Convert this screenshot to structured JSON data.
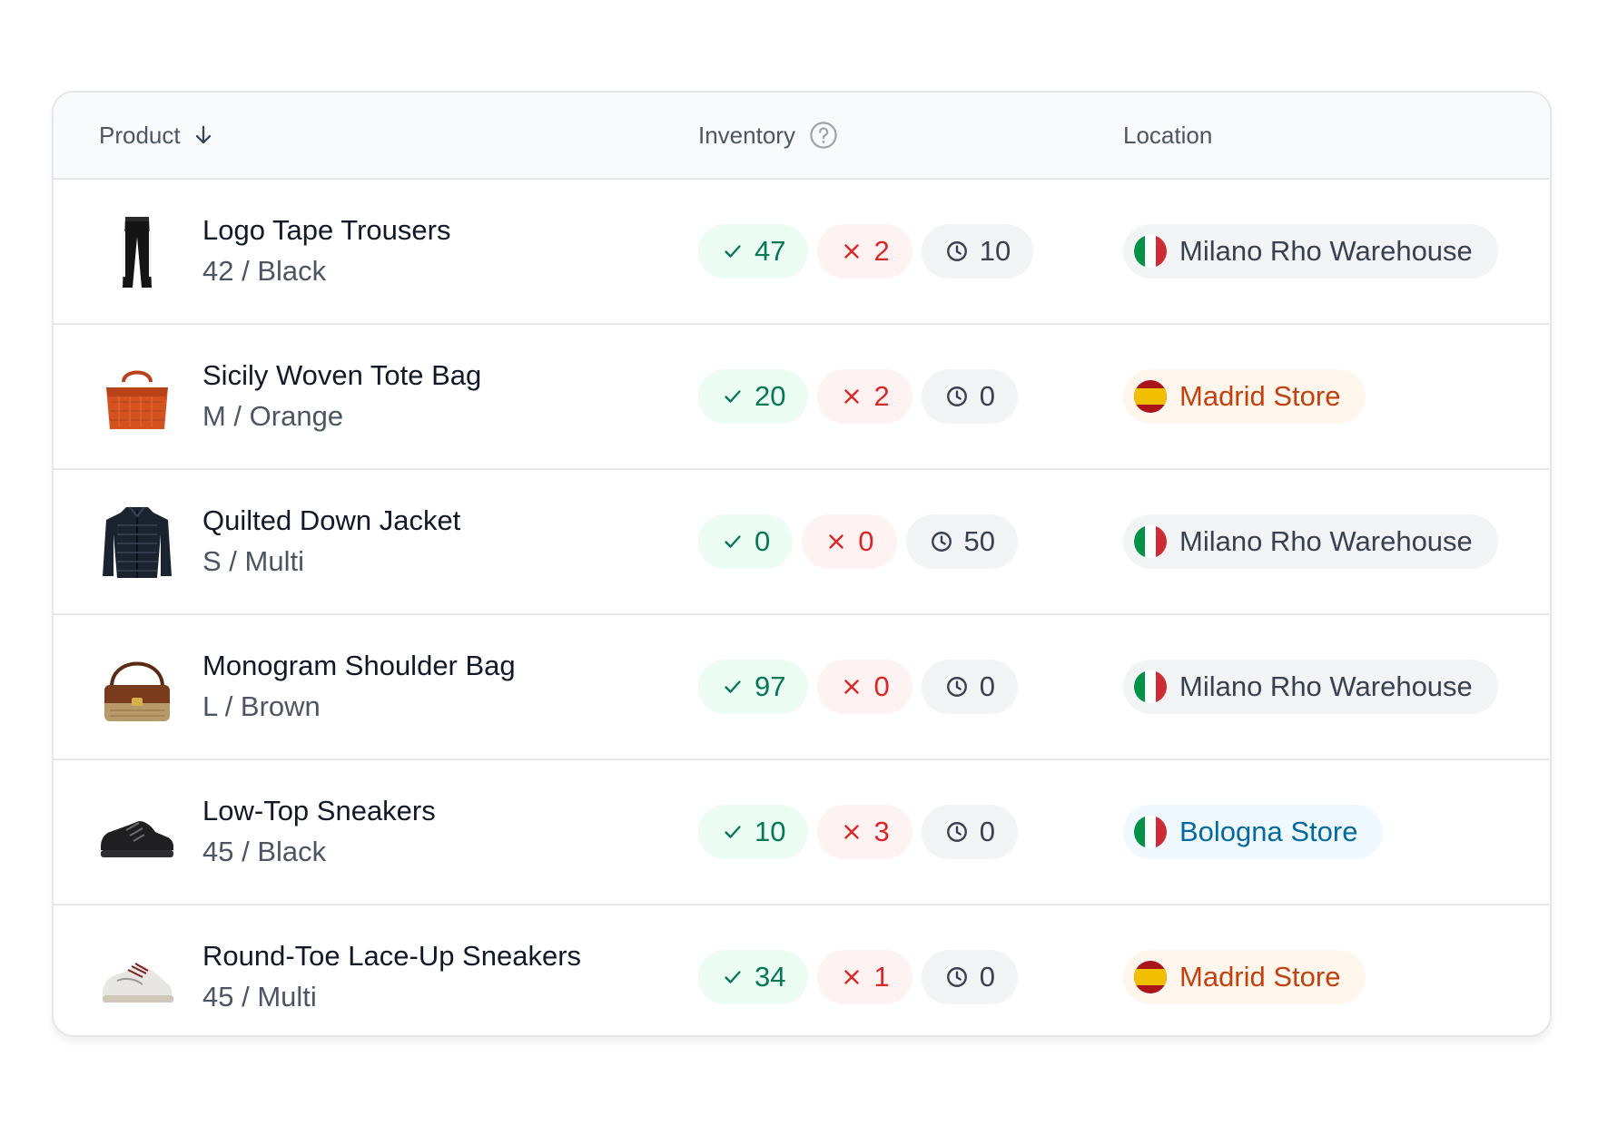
{
  "header": {
    "product": "Product",
    "inventory": "Inventory",
    "location": "Location",
    "product_sort_icon": "arrow-down-icon",
    "inventory_help_icon": "question-circle-icon"
  },
  "colors": {
    "available_bg": "#ECFDF3",
    "available_text": "#047857",
    "unavailable_bg": "#FEF2F2",
    "unavailable_text": "#DC2626",
    "pending_bg": "#F3F4F6",
    "pending_text": "#374151",
    "location_neutral_bg": "#F3F4F6",
    "location_orange_bg": "#FFF7ED",
    "location_orange_text": "#C2410C",
    "location_blue_bg": "#F0F9FF",
    "location_blue_text": "#0369A1"
  },
  "rows": [
    {
      "name": "Logo Tape Trousers",
      "variant": "42 / Black",
      "thumbnail": "trousers",
      "available": "47",
      "unavailable": "2",
      "pending": "10",
      "location": "Milano Rho Warehouse",
      "location_flag": "italy-flag-icon",
      "location_style": "neutral"
    },
    {
      "name": "Sicily Woven Tote Bag",
      "variant": "M / Orange",
      "thumbnail": "tote-bag",
      "available": "20",
      "unavailable": "2",
      "pending": "0",
      "location": "Madrid Store",
      "location_flag": "spain-flag-icon",
      "location_style": "orange"
    },
    {
      "name": "Quilted Down Jacket",
      "variant": "S / Multi",
      "thumbnail": "jacket",
      "available": "0",
      "unavailable": "0",
      "pending": "50",
      "location": "Milano Rho Warehouse",
      "location_flag": "italy-flag-icon",
      "location_style": "neutral"
    },
    {
      "name": "Monogram Shoulder Bag",
      "variant": "L / Brown",
      "thumbnail": "shoulder-bag",
      "available": "97",
      "unavailable": "0",
      "pending": "0",
      "location": "Milano Rho Warehouse",
      "location_flag": "italy-flag-icon",
      "location_style": "neutral"
    },
    {
      "name": "Low-Top Sneakers",
      "variant": "45 / Black",
      "thumbnail": "black-sneaker",
      "available": "10",
      "unavailable": "3",
      "pending": "0",
      "location": "Bologna Store",
      "location_flag": "italy-flag-icon",
      "location_style": "blue"
    },
    {
      "name": "Round-Toe Lace-Up Sneakers",
      "variant": "45 / Multi",
      "thumbnail": "white-sneaker",
      "available": "34",
      "unavailable": "1",
      "pending": "0",
      "location": "Madrid Store",
      "location_flag": "spain-flag-icon",
      "location_style": "orange"
    }
  ]
}
